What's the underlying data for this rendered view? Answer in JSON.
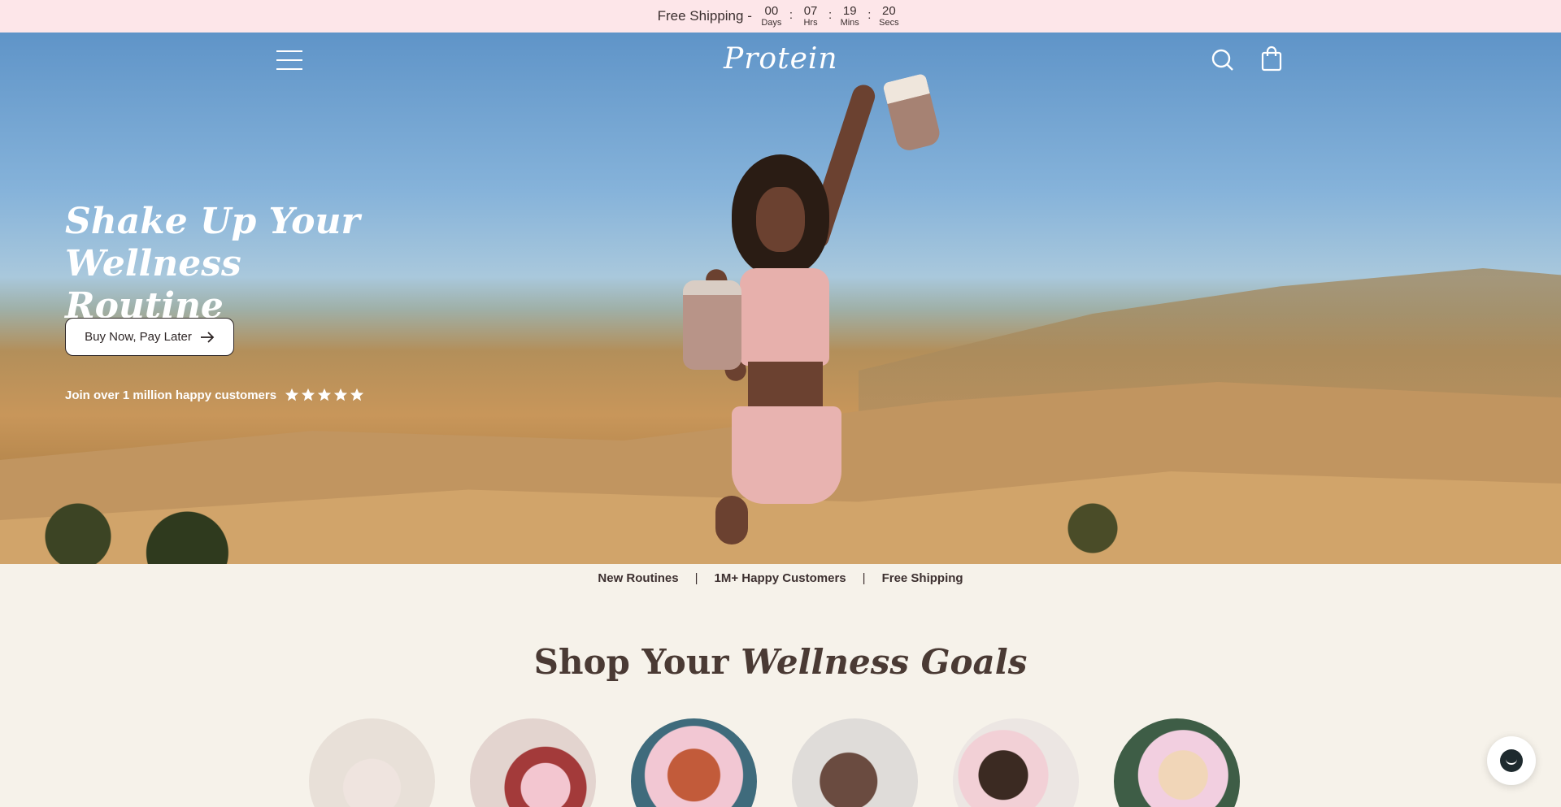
{
  "announcement": {
    "text": "Free Shipping -",
    "countdown": [
      {
        "value": "00",
        "label": "Days"
      },
      {
        "value": "07",
        "label": "Hrs"
      },
      {
        "value": "19",
        "label": "Mins"
      },
      {
        "value": "20",
        "label": "Secs"
      }
    ],
    "separator": ":"
  },
  "header": {
    "logo": "Protein",
    "menu_icon": "hamburger-menu-icon",
    "search_icon": "search-icon",
    "cart_icon": "shopping-bag-icon"
  },
  "hero": {
    "title_line1": "Shake Up Your",
    "title_line2": "Wellness Routine",
    "cta_label": "Buy Now, Pay Later",
    "cta_icon": "arrow-right-icon",
    "social_proof": "Join over 1 million happy customers",
    "rating_stars": 5
  },
  "trust_bar": {
    "items": [
      "New Routines",
      "1M+ Happy Customers",
      "Free Shipping"
    ],
    "separator": "|"
  },
  "section": {
    "title_plain": "Shop Your",
    "title_emphasis": "Wellness Goals"
  },
  "chat": {
    "icon": "chat-icon"
  },
  "colors": {
    "announcement_bg": "#fde6e9",
    "page_bg": "#f6f2ea",
    "text_dark": "#3d3030"
  }
}
